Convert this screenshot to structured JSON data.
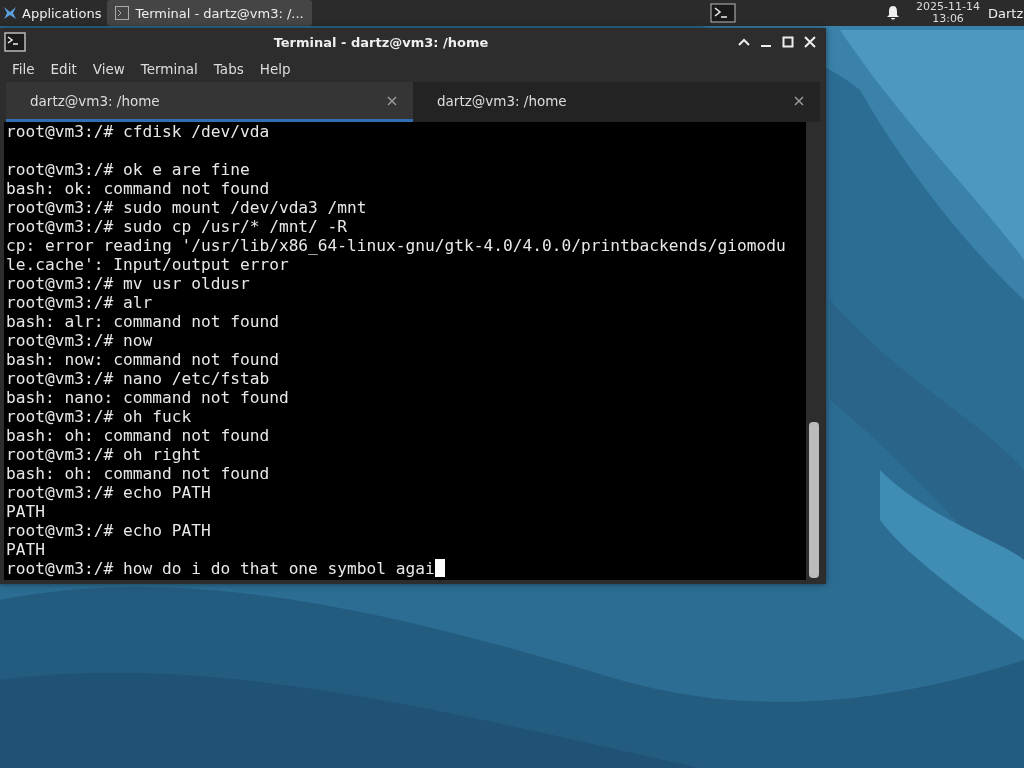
{
  "panel": {
    "app_menu": "Applications",
    "tasks": [
      {
        "title": "Terminal - dartz@vm3: /...",
        "selected": true
      }
    ],
    "clock_date": "2025-11-14",
    "clock_time": "13:06",
    "user": "Dartz"
  },
  "window": {
    "title": "Terminal - dartz@vm3: /home",
    "menu": [
      "File",
      "Edit",
      "View",
      "Terminal",
      "Tabs",
      "Help"
    ],
    "tabs": [
      {
        "label": "dartz@vm3: /home",
        "selected": true
      },
      {
        "label": "dartz@vm3: /home",
        "selected": false
      }
    ],
    "lines": [
      {
        "kind": "text",
        "text": "root@vm3:/# cfdisk /dev/vda"
      },
      {
        "kind": "blank"
      },
      {
        "kind": "text",
        "text": "root@vm3:/# ok e are fine"
      },
      {
        "kind": "text",
        "text": "bash: ok: command not found"
      },
      {
        "kind": "text",
        "text": "root@vm3:/# sudo mount /dev/vda3 /mnt"
      },
      {
        "kind": "text",
        "text": "root@vm3:/# sudo cp /usr/* /mnt/ -R"
      },
      {
        "kind": "text",
        "text": "cp: error reading '/usr/lib/x86_64-linux-gnu/gtk-4.0/4.0.0/printbackends/giomodu"
      },
      {
        "kind": "text",
        "text": "le.cache': Input/output error"
      },
      {
        "kind": "text",
        "text": "root@vm3:/# mv usr oldusr"
      },
      {
        "kind": "text",
        "text": "root@vm3:/# alr"
      },
      {
        "kind": "text",
        "text": "bash: alr: command not found"
      },
      {
        "kind": "text",
        "text": "root@vm3:/# now"
      },
      {
        "kind": "text",
        "text": "bash: now: command not found"
      },
      {
        "kind": "text",
        "text": "root@vm3:/# nano /etc/fstab"
      },
      {
        "kind": "text",
        "text": "bash: nano: command not found"
      },
      {
        "kind": "text",
        "text": "root@vm3:/# oh fuck"
      },
      {
        "kind": "text",
        "text": "bash: oh: command not found"
      },
      {
        "kind": "text",
        "text": "root@vm3:/# oh right"
      },
      {
        "kind": "text",
        "text": "bash: oh: command not found"
      },
      {
        "kind": "text",
        "text": "root@vm3:/# echo PATH"
      },
      {
        "kind": "text",
        "text": "PATH"
      },
      {
        "kind": "text",
        "text": "root@vm3:/# echo PATH"
      },
      {
        "kind": "text",
        "text": "PATH"
      },
      {
        "kind": "input",
        "text": "root@vm3:/# how do i do that one symbol agai"
      }
    ]
  }
}
